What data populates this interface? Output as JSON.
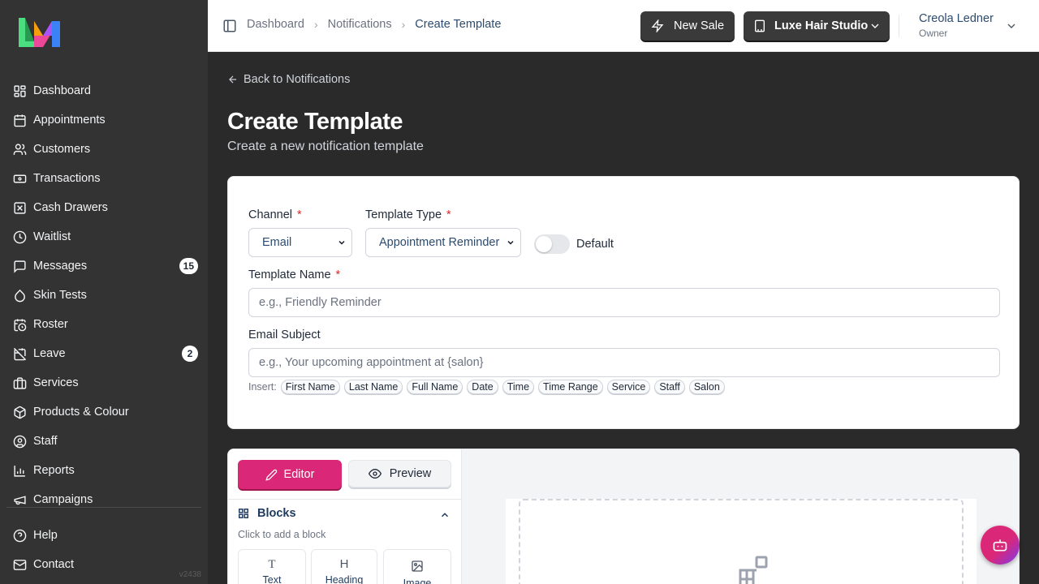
{
  "app": {
    "version": "v2438",
    "brand_colors": {
      "logo_green": "#4ade80",
      "logo_pink": "#ec4899",
      "logo_orange": "#f59e0b",
      "logo_blue": "#3b82f6",
      "accent": "#db2777"
    }
  },
  "sidebar": {
    "items": [
      {
        "label": "Dashboard",
        "icon": "dashboard-icon"
      },
      {
        "label": "Appointments",
        "icon": "calendar-icon"
      },
      {
        "label": "Customers",
        "icon": "users-icon"
      },
      {
        "label": "Transactions",
        "icon": "banknote-icon"
      },
      {
        "label": "Cash Drawers",
        "icon": "cash-drawer-icon"
      },
      {
        "label": "Waitlist",
        "icon": "clock-icon"
      },
      {
        "label": "Messages",
        "icon": "message-icon",
        "badge": "15"
      },
      {
        "label": "Skin Tests",
        "icon": "droplet-icon"
      },
      {
        "label": "Roster",
        "icon": "calendar-clock-icon"
      },
      {
        "label": "Leave",
        "icon": "calendar-off-icon",
        "badge": "2"
      },
      {
        "label": "Services",
        "icon": "briefcase-icon"
      },
      {
        "label": "Products & Colour",
        "icon": "package-icon"
      },
      {
        "label": "Staff",
        "icon": "user-circle-icon"
      },
      {
        "label": "Reports",
        "icon": "bar-chart-icon"
      },
      {
        "label": "Campaigns",
        "icon": "megaphone-icon"
      }
    ],
    "bottom_items": [
      {
        "label": "Help",
        "icon": "help-icon"
      },
      {
        "label": "Contact",
        "icon": "mail-icon"
      }
    ]
  },
  "topbar": {
    "breadcrumb": [
      "Dashboard",
      "Notifications",
      "Create Template"
    ],
    "new_sale_label": "New Sale",
    "salon_label": "Luxe Hair Studio",
    "user_name": "Creola Ledner",
    "user_role": "Owner"
  },
  "page": {
    "back_label": "Back to Notifications",
    "title": "Create Template",
    "subtitle": "Create a new notification template"
  },
  "form": {
    "channel_label": "Channel",
    "channel_value": "Email",
    "template_type_label": "Template Type",
    "template_type_value": "Appointment Reminder",
    "default_label": "Default",
    "default_on": false,
    "required_mark": "*",
    "template_name_label": "Template Name",
    "template_name_placeholder": "e.g., Friendly Reminder",
    "email_subject_label": "Email Subject",
    "email_subject_placeholder": "e.g., Your upcoming appointment at {salon}",
    "insert_label": "Insert:",
    "insert_chips": [
      "First Name",
      "Last Name",
      "Full Name",
      "Date",
      "Time",
      "Time Range",
      "Service",
      "Staff",
      "Salon"
    ]
  },
  "editor": {
    "editor_label": "Editor",
    "preview_label": "Preview",
    "blocks_title": "Blocks",
    "blocks_hint": "Click to add a block",
    "blocks": [
      {
        "label": "Text",
        "glyph": "T"
      },
      {
        "label": "Heading",
        "glyph": "H"
      },
      {
        "label": "Image",
        "glyph": "image-icon"
      }
    ]
  }
}
